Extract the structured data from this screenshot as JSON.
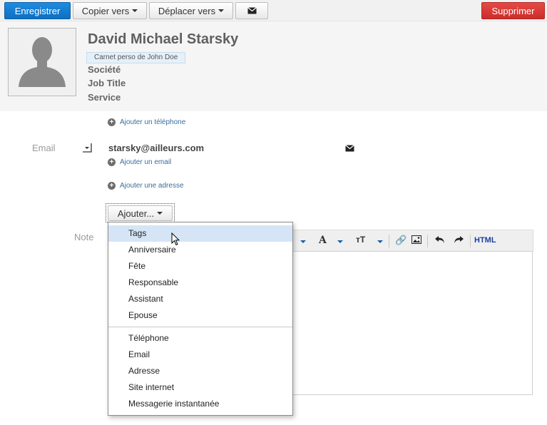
{
  "toolbar": {
    "save": "Enregistrer",
    "copy": "Copier vers",
    "move": "Déplacer vers",
    "delete": "Supprimer"
  },
  "contact": {
    "name": "David Michael Starsky",
    "address_book": "Carnet perso de John Doe",
    "company": "Société",
    "job_title": "Job Title",
    "service": "Service"
  },
  "fields": {
    "add_phone": "Ajouter un téléphone",
    "email_label": "Email",
    "email_value": "starsky@ailleurs.com",
    "add_email": "Ajouter un email",
    "add_address": "Ajouter une adresse",
    "add_button": "Ajouter...",
    "note_label": "Note"
  },
  "editor": {
    "html_label": "HTML"
  },
  "menu": {
    "group1": [
      "Tags",
      "Anniversaire",
      "Fête",
      "Responsable",
      "Assistant",
      "Epouse"
    ],
    "group2": [
      "Téléphone",
      "Email",
      "Adresse",
      "Site internet",
      "Messagerie instantanée"
    ],
    "highlighted": "Tags"
  },
  "colors": {
    "primary": "#0d6fc2",
    "danger": "#cc2d2a",
    "link": "#3a6d9c",
    "menu_highlight": "#d5e5f5"
  }
}
